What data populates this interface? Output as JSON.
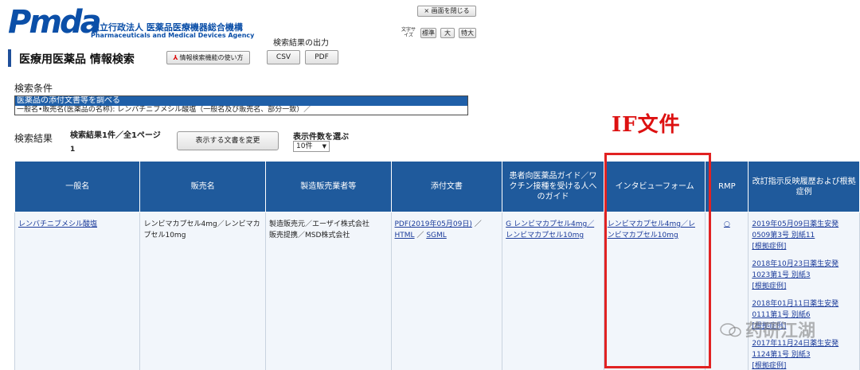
{
  "header": {
    "logo_text": "Pmda",
    "org_name_jp": "独立行政法人 医薬品医療機器総合機構",
    "org_name_en": "Pharmaceuticals and Medical Devices Agency",
    "close_button": "× 画面を閉じる",
    "font_size_label": "文字サイズ",
    "font_sizes": [
      "標準",
      "大",
      "特大"
    ]
  },
  "page": {
    "title": "医療用医薬品 情報検索",
    "howto_button": "情報検索機能の使い方",
    "output_label": "検索結果の出力",
    "csv_button": "CSV",
    "pdf_button": "PDF"
  },
  "conditions": {
    "label": "検索条件",
    "row1": "医薬品の添付文書等を調べる",
    "row2": "一般名•販売名(医薬品の名称): レンバチニブメシル酸塩（一般名及び販売名、部分一致）／"
  },
  "results": {
    "label": "検索結果",
    "count_text": "検索結果1件／全1ページ",
    "page_number": "1",
    "change_docs_button": "表示する文書を変更",
    "per_page_label": "表示件数を選ぶ",
    "per_page_value": "10件"
  },
  "annotation": "IF文件",
  "table": {
    "headers": [
      "一般名",
      "販売名",
      "製造販売業者等",
      "添付文書",
      "患者向医薬品ガイド／ワクチン接種を受ける人へのガイド",
      "インタビューフォーム",
      "RMP",
      "改訂指示反映履歴および根拠症例"
    ],
    "row": {
      "generic_name": "レンバチニブメシル酸塩",
      "brand_name": "レンビマカプセル4mg／レンビマカプセル10mg",
      "manufacturer_1": "製造販売元／エーザイ株式会社",
      "manufacturer_2": "販売提携／MSD株式会社",
      "package_pdf": "PDF(2019年05月09日)",
      "sep1": "／",
      "package_html": "HTML",
      "sep2": "／",
      "package_sgml": "SGML",
      "patient_guide": "G レンビマカプセル4mg／レンビマカプセル10mg",
      "interview_form": "レンビマカプセル4mg／レンビマカプセル10mg",
      "rmp": "○",
      "history": [
        {
          "link": "2019年05月09日薬生安発0509第3号 別紙11",
          "basis": "[根拠症例]"
        },
        {
          "link": "2018年10月23日薬生安発1023第1号 別紙3",
          "basis": "[根拠症例]"
        },
        {
          "link": "2018年01月11日薬生安発0111第1号 別紙6",
          "basis": "[根拠症例]"
        },
        {
          "link": "2017年11月24日薬生安発1124第1号 別紙3",
          "basis": "[根拠症例]"
        }
      ]
    }
  },
  "watermark": "药研江湖"
}
